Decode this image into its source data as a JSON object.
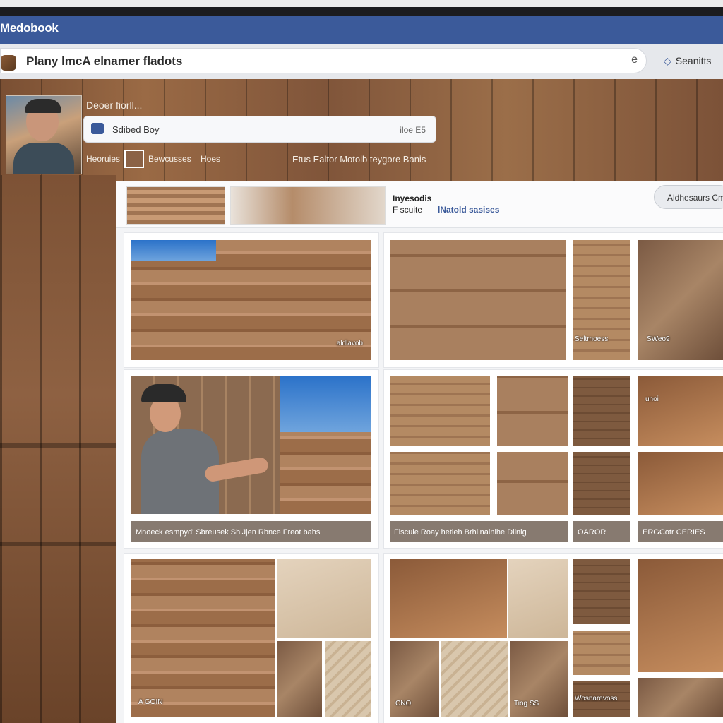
{
  "app": {
    "brand": "Medobook"
  },
  "search": {
    "query": "Plany lmcA elnamer fladots",
    "clear_icon": "e",
    "submit_label": "Seanitts"
  },
  "profile": {
    "name": "Deoer fiorll...",
    "post_placeholder": "Sdibed Boy",
    "post_time": "iloe E5",
    "tags": [
      "Heoruies",
      "Bewcusses",
      "Hoes"
    ],
    "caption": "Etus Ealtor Motoib teygore Banis"
  },
  "album": {
    "line1": "Inyesodis",
    "line2_prefix": "F scuite",
    "line2_link": "lNatold sasises",
    "button": "Aldhesaurs Cm"
  },
  "tiles": {
    "t1_label": "aldlavob",
    "t2_label": "Seltrnoess",
    "t3_label": "SWeo9",
    "worker_caption": "Mnoeck esmpyd' Sbreusek ShiJjen Rbnce Freot bahs",
    "wide_caption": "Fiscule Roay hetleh Brhlinalnlhe Dlinig",
    "small_caption_1": "OAROR",
    "small_caption_2": "ERGCotr CERIES",
    "side_overlay": "unoi",
    "bottom_1": "A GOIN",
    "bottom_2": "CNO",
    "bottom_3": "Tiog SS",
    "bottom_4": "Wosnarevoss"
  },
  "colors": {
    "brand_blue": "#3b5a9a",
    "wood": "#8b5e3d"
  }
}
